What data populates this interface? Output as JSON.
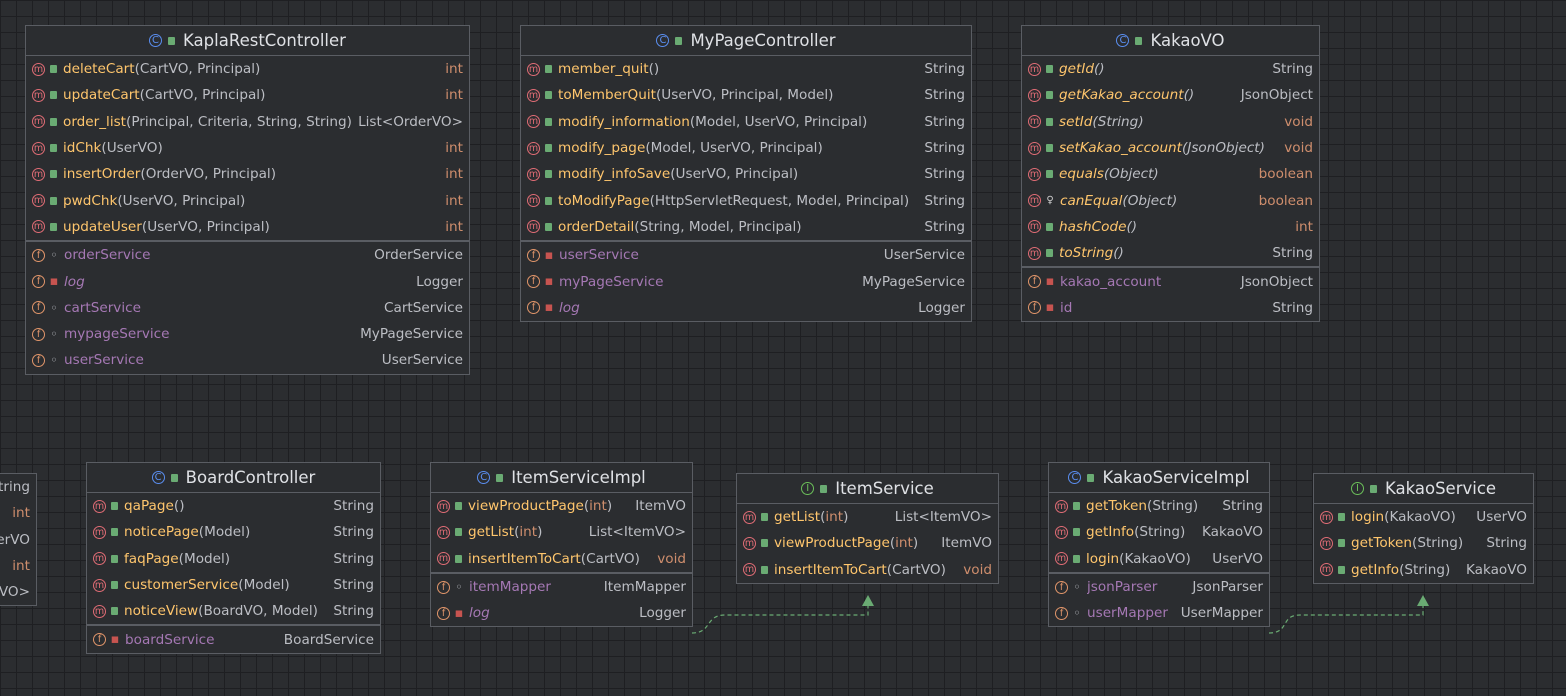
{
  "colors": {
    "background": "#2b2d30",
    "grid": "#1e1f22",
    "method_name": "#ffc66d",
    "field_name": "#a578b4",
    "primitive_type": "#cf8e6d",
    "arrow": "#6aab73"
  },
  "classes": [
    {
      "id": "kapla",
      "name": "KaplaRestController",
      "kind": "class",
      "methods": [
        {
          "vis": "pub",
          "name": "deleteCart",
          "args": "(CartVO, Principal)",
          "type": "int",
          "prim": true
        },
        {
          "vis": "pub",
          "name": "updateCart",
          "args": "(CartVO, Principal)",
          "type": "int",
          "prim": true
        },
        {
          "vis": "pub",
          "name": "order_list",
          "args": "(Principal, Criteria, String, String)",
          "type": "List<OrderVO>",
          "prim": false
        },
        {
          "vis": "pub",
          "name": "idChk",
          "args": "(UserVO)",
          "type": "int",
          "prim": true
        },
        {
          "vis": "pub",
          "name": "insertOrder",
          "args": "(OrderVO, Principal)",
          "type": "int",
          "prim": true
        },
        {
          "vis": "pub",
          "name": "pwdChk",
          "args": "(UserVO, Principal)",
          "type": "int",
          "prim": true
        },
        {
          "vis": "pub",
          "name": "updateUser",
          "args": "(UserVO, Principal)",
          "type": "int",
          "prim": true
        }
      ],
      "fields": [
        {
          "vis": "pkg",
          "name": "orderService",
          "type": "OrderService"
        },
        {
          "vis": "prv",
          "name": "log",
          "type": "Logger",
          "italic": true
        },
        {
          "vis": "pkg",
          "name": "cartService",
          "type": "CartService"
        },
        {
          "vis": "pkg",
          "name": "mypageService",
          "type": "MyPageService"
        },
        {
          "vis": "pkg",
          "name": "userService",
          "type": "UserService"
        }
      ]
    },
    {
      "id": "mypage",
      "name": "MyPageController",
      "kind": "class",
      "methods": [
        {
          "vis": "pub",
          "name": "member_quit",
          "args": "()",
          "type": "String"
        },
        {
          "vis": "pub",
          "name": "toMemberQuit",
          "args": "(UserVO, Principal, Model)",
          "type": "String"
        },
        {
          "vis": "pub",
          "name": "modify_information",
          "args": "(Model, UserVO, Principal)",
          "type": "String"
        },
        {
          "vis": "pub",
          "name": "modify_page",
          "args": "(Model, UserVO, Principal)",
          "type": "String"
        },
        {
          "vis": "pub",
          "name": "modify_infoSave",
          "args": "(UserVO, Principal)",
          "type": "String"
        },
        {
          "vis": "pub",
          "name": "toModifyPage",
          "args": "(HttpServletRequest, Model, Principal)",
          "type": "String"
        },
        {
          "vis": "pub",
          "name": "orderDetail",
          "args": "(String, Model, Principal)",
          "type": "String"
        }
      ],
      "fields": [
        {
          "vis": "prv",
          "name": "userService",
          "type": "UserService"
        },
        {
          "vis": "prv",
          "name": "myPageService",
          "type": "MyPageService"
        },
        {
          "vis": "prv",
          "name": "log",
          "type": "Logger",
          "italic": true
        }
      ]
    },
    {
      "id": "kakaovo",
      "name": "KakaoVO",
      "kind": "class",
      "methods": [
        {
          "vis": "pub",
          "name": "getId",
          "args": "()",
          "type": "String",
          "italic": true
        },
        {
          "vis": "pub",
          "name": "getKakao_account",
          "args": "()",
          "type": "JsonObject",
          "italic": true
        },
        {
          "vis": "pub",
          "name": "setId",
          "args": "(String)",
          "type": "void",
          "prim": true,
          "italic": true
        },
        {
          "vis": "pub",
          "name": "setKakao_account",
          "args": "(JsonObject)",
          "type": "void",
          "prim": true,
          "italic": true
        },
        {
          "vis": "pub",
          "name": "equals",
          "args": "(Object)",
          "type": "boolean",
          "prim": true,
          "italic": true
        },
        {
          "vis": "prot",
          "name": "canEqual",
          "args": "(Object)",
          "type": "boolean",
          "prim": true,
          "italic": true
        },
        {
          "vis": "pub",
          "name": "hashCode",
          "args": "()",
          "type": "int",
          "prim": true,
          "italic": true
        },
        {
          "vis": "pub",
          "name": "toString",
          "args": "()",
          "type": "String",
          "italic": true
        }
      ],
      "fields": [
        {
          "vis": "prv",
          "name": "kakao_account",
          "type": "JsonObject"
        },
        {
          "vis": "prv",
          "name": "id",
          "type": "String"
        }
      ]
    },
    {
      "id": "partial",
      "name": "",
      "kind": "class",
      "methods": [
        {
          "vis": "pub",
          "name": "",
          "args": "",
          "type": "tring"
        },
        {
          "vis": "pub",
          "name": "",
          "args": "",
          "type": "int",
          "prim": true
        },
        {
          "vis": "pub",
          "name": "",
          "args": "",
          "type": "erVO"
        },
        {
          "vis": "pub",
          "name": "",
          "args": "",
          "type": "int",
          "prim": true
        },
        {
          "vis": "pub",
          "name": "",
          "args": "",
          "type": "VO>"
        }
      ],
      "fields": []
    },
    {
      "id": "board",
      "name": "BoardController",
      "kind": "class",
      "methods": [
        {
          "vis": "pub",
          "name": "qaPage",
          "args": "()",
          "type": "String"
        },
        {
          "vis": "pub",
          "name": "noticePage",
          "args": "(Model)",
          "type": "String"
        },
        {
          "vis": "pub",
          "name": "faqPage",
          "args": "(Model)",
          "type": "String"
        },
        {
          "vis": "pub",
          "name": "customerService",
          "args": "(Model)",
          "type": "String"
        },
        {
          "vis": "pub",
          "name": "noticeView",
          "args": "(BoardVO, Model)",
          "type": "String"
        }
      ],
      "fields": [
        {
          "vis": "prv",
          "name": "boardService",
          "type": "BoardService"
        }
      ]
    },
    {
      "id": "itemimpl",
      "name": "ItemServiceImpl",
      "kind": "class",
      "methods": [
        {
          "vis": "pub",
          "name": "viewProductPage",
          "args": "(int)",
          "type": "ItemVO",
          "primArg": true
        },
        {
          "vis": "pub",
          "name": "getList",
          "args": "(int)",
          "type": "List<ItemVO>",
          "primArg": true
        },
        {
          "vis": "pub",
          "name": "insertItemToCart",
          "args": "(CartVO)",
          "type": "void",
          "prim": true
        }
      ],
      "fields": [
        {
          "vis": "pkg",
          "name": "itemMapper",
          "type": "ItemMapper"
        },
        {
          "vis": "prv",
          "name": "log",
          "type": "Logger",
          "italic": true
        }
      ]
    },
    {
      "id": "itemservice",
      "name": "ItemService",
      "kind": "interface",
      "methods": [
        {
          "vis": "pub",
          "name": "getList",
          "args": "(int)",
          "type": "List<ItemVO>",
          "primArg": true
        },
        {
          "vis": "pub",
          "name": "viewProductPage",
          "args": "(int)",
          "type": "ItemVO",
          "primArg": true
        },
        {
          "vis": "pub",
          "name": "insertItemToCart",
          "args": "(CartVO)",
          "type": "void",
          "prim": true
        }
      ],
      "fields": []
    },
    {
      "id": "kakaoimpl",
      "name": "KakaoServiceImpl",
      "kind": "class",
      "methods": [
        {
          "vis": "pub",
          "name": "getToken",
          "args": "(String)",
          "type": "String"
        },
        {
          "vis": "pub",
          "name": "getInfo",
          "args": "(String)",
          "type": "KakaoVO"
        },
        {
          "vis": "pub",
          "name": "login",
          "args": "(KakaoVO)",
          "type": "UserVO"
        }
      ],
      "fields": [
        {
          "vis": "pkg",
          "name": "jsonParser",
          "type": "JsonParser"
        },
        {
          "vis": "pkg",
          "name": "userMapper",
          "type": "UserMapper"
        }
      ]
    },
    {
      "id": "kakaoservice",
      "name": "KakaoService",
      "kind": "interface",
      "methods": [
        {
          "vis": "pub",
          "name": "login",
          "args": "(KakaoVO)",
          "type": "UserVO"
        },
        {
          "vis": "pub",
          "name": "getToken",
          "args": "(String)",
          "type": "String"
        },
        {
          "vis": "pub",
          "name": "getInfo",
          "args": "(String)",
          "type": "KakaoVO"
        }
      ],
      "fields": []
    }
  ],
  "links": [
    {
      "from": "itemimpl",
      "to": "itemservice",
      "kind": "implements"
    },
    {
      "from": "kakaoimpl",
      "to": "kakaoservice",
      "kind": "implements"
    }
  ]
}
